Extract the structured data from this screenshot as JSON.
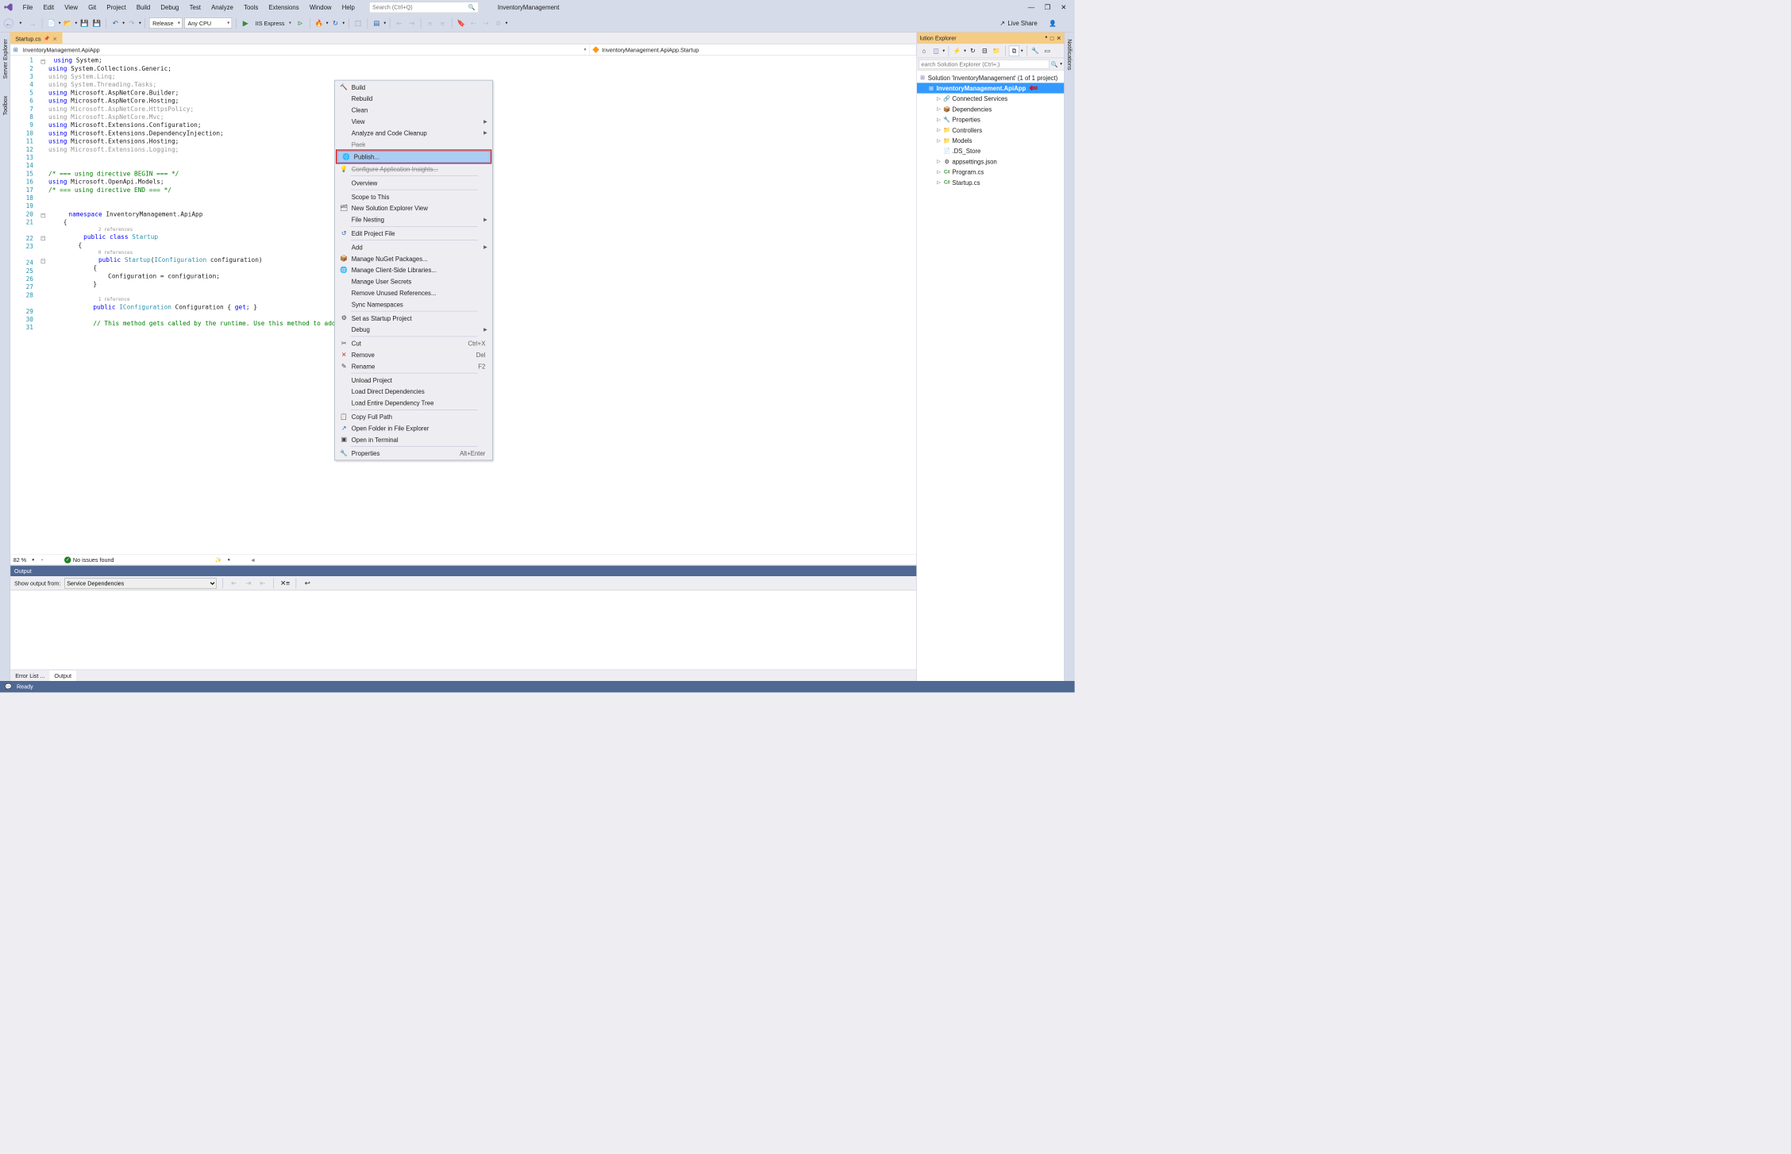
{
  "title": "InventoryManagement",
  "menu": [
    "File",
    "Edit",
    "View",
    "Git",
    "Project",
    "Build",
    "Debug",
    "Test",
    "Analyze",
    "Tools",
    "Extensions",
    "Window",
    "Help"
  ],
  "search_placeholder": "Search (Ctrl+Q)",
  "toolbar": {
    "config": "Release",
    "platform": "Any CPU",
    "run_target": "IIS Express",
    "live_share": "Live Share"
  },
  "left_rails": [
    "Server Explorer",
    "Toolbox"
  ],
  "right_rails": [
    "Notifications"
  ],
  "tab": {
    "name": "Startup.cs"
  },
  "nav": {
    "left": "InventoryManagement.ApiApp",
    "right": "InventoryManagement.ApiApp.Startup"
  },
  "code_lines": [
    {
      "n": 1,
      "html": "<span class='kw'>using</span> System;",
      "fold": "minus"
    },
    {
      "n": 2,
      "html": "<span class='kw'>using</span> System.Collections.Generic;"
    },
    {
      "n": 3,
      "html": "<span class='gray'>using System.Linq;</span>"
    },
    {
      "n": 4,
      "html": "<span class='gray'>using System.Threading.Tasks;</span>"
    },
    {
      "n": 5,
      "html": "<span class='kw'>using</span> Microsoft.AspNetCore.Builder;"
    },
    {
      "n": 6,
      "html": "<span class='kw'>using</span> Microsoft.AspNetCore.Hosting;"
    },
    {
      "n": 7,
      "html": "<span class='gray'>using Microsoft.AspNetCore.HttpsPolicy;</span>"
    },
    {
      "n": 8,
      "html": "<span class='gray'>using Microsoft.AspNetCore.Mvc;</span>"
    },
    {
      "n": 9,
      "html": "<span class='kw'>using</span> Microsoft.Extensions.Configuration;"
    },
    {
      "n": 10,
      "html": "<span class='kw'>using</span> Microsoft.Extensions.DependencyInjection;"
    },
    {
      "n": 11,
      "html": "<span class='kw'>using</span> Microsoft.Extensions.Hosting;"
    },
    {
      "n": 12,
      "html": "<span class='gray'>using Microsoft.Extensions.Logging;</span>"
    },
    {
      "n": 13,
      "html": ""
    },
    {
      "n": 14,
      "html": ""
    },
    {
      "n": 15,
      "html": "<span class='comment'>/* === using directive BEGIN === */</span>"
    },
    {
      "n": 16,
      "html": "<span class='kw'>using</span> Microsoft.OpenApi.Models;"
    },
    {
      "n": 17,
      "html": "<span class='comment'>/* === using directive END === */</span>"
    },
    {
      "n": 18,
      "html": ""
    },
    {
      "n": 19,
      "html": ""
    },
    {
      "n": 20,
      "html": "    <span class='kw'>namespace</span> InventoryManagement.ApiApp",
      "fold": "minus"
    },
    {
      "n": 21,
      "html": "    {"
    },
    {
      "ref": "2 references"
    },
    {
      "n": 22,
      "html": "        <span class='kw'>public</span> <span class='kw'>class</span> <span class='type'>Startup</span>",
      "fold": "minus"
    },
    {
      "n": 23,
      "html": "        {"
    },
    {
      "ref": "0 references"
    },
    {
      "n": 24,
      "html": "            <span class='kw'>public</span> <span class='type'>Startup</span>(<span class='type'>IConfiguration</span> configuration)",
      "fold": "minus"
    },
    {
      "n": 25,
      "html": "            {"
    },
    {
      "n": 26,
      "html": "                Configuration = configuration;"
    },
    {
      "n": 27,
      "html": "            }"
    },
    {
      "n": 28,
      "html": ""
    },
    {
      "ref": "1 reference"
    },
    {
      "n": 29,
      "html": "            <span class='kw'>public</span> <span class='type'>IConfiguration</span> Configuration { <span class='kw'>get</span>; }"
    },
    {
      "n": 30,
      "html": ""
    },
    {
      "n": 31,
      "html": "            <span class='comment'>// This method gets called by the runtime. Use this method to add services to</span>"
    }
  ],
  "editor_status": {
    "zoom": "82 %",
    "issues": "No issues found"
  },
  "output": {
    "title": "Output",
    "source_label": "Show output from:",
    "source": "Service Dependencies"
  },
  "bottom_tabs": [
    "Error List  ...",
    "Output"
  ],
  "status_text": "Ready",
  "solution_explorer": {
    "title": "lution Explorer",
    "search_placeholder": "earch Solution Explorer (Ctrl+;)",
    "root": "Solution 'InventoryManagement' (1 of 1 project)",
    "project": "InventoryManagement.ApiApp",
    "children": [
      {
        "icon": "🔗",
        "label": "Connected Services",
        "exp": true
      },
      {
        "icon": "📦",
        "label": "Dependencies",
        "exp": true
      },
      {
        "icon": "🔧",
        "label": "Properties",
        "exp": true
      },
      {
        "icon": "📁",
        "label": "Controllers",
        "exp": true
      },
      {
        "icon": "📁",
        "label": "Models",
        "exp": true
      },
      {
        "icon": "📄",
        "label": ".DS_Store",
        "exp": false
      },
      {
        "icon": "⚙",
        "label": "appsettings.json",
        "exp": true
      },
      {
        "icon": "C#",
        "label": "Program.cs",
        "exp": true,
        "cs": true
      },
      {
        "icon": "C#",
        "label": "Startup.cs",
        "exp": true,
        "cs": true
      }
    ]
  },
  "context_menu": [
    {
      "type": "item",
      "icon": "🔨",
      "label": "Build"
    },
    {
      "type": "item",
      "label": "Rebuild"
    },
    {
      "type": "item",
      "label": "Clean"
    },
    {
      "type": "item",
      "label": "View",
      "sub": true
    },
    {
      "type": "item",
      "label": "Analyze and Code Cleanup",
      "sub": true
    },
    {
      "type": "item",
      "label": "Pack",
      "strike": true
    },
    {
      "type": "item",
      "icon": "🌐",
      "label": "Publish...",
      "highlight": true
    },
    {
      "type": "item",
      "icon": "💡",
      "label": "Configure Application Insights...",
      "strike": true
    },
    {
      "type": "sep"
    },
    {
      "type": "item",
      "label": "Overview"
    },
    {
      "type": "sep"
    },
    {
      "type": "item",
      "label": "Scope to This"
    },
    {
      "type": "item",
      "icon": "🗂",
      "label": "New Solution Explorer View"
    },
    {
      "type": "item",
      "label": "File Nesting",
      "sub": true
    },
    {
      "type": "sep"
    },
    {
      "type": "item",
      "icon": "↺",
      "label": "Edit Project File"
    },
    {
      "type": "sep"
    },
    {
      "type": "item",
      "label": "Add",
      "sub": true
    },
    {
      "type": "item",
      "icon": "📦",
      "label": "Manage NuGet Packages..."
    },
    {
      "type": "item",
      "icon": "🌐",
      "label": "Manage Client-Side Libraries..."
    },
    {
      "type": "item",
      "label": "Manage User Secrets"
    },
    {
      "type": "item",
      "label": "Remove Unused References..."
    },
    {
      "type": "item",
      "label": "Sync Namespaces"
    },
    {
      "type": "sep"
    },
    {
      "type": "item",
      "icon": "⚙",
      "label": "Set as Startup Project"
    },
    {
      "type": "item",
      "label": "Debug",
      "sub": true
    },
    {
      "type": "sep"
    },
    {
      "type": "item",
      "icon": "✂",
      "label": "Cut",
      "shortcut": "Ctrl+X"
    },
    {
      "type": "item",
      "icon": "✕",
      "label": "Remove",
      "shortcut": "Del"
    },
    {
      "type": "item",
      "icon": "✎",
      "label": "Rename",
      "shortcut": "F2"
    },
    {
      "type": "sep"
    },
    {
      "type": "item",
      "label": "Unload Project"
    },
    {
      "type": "item",
      "label": "Load Direct Dependencies"
    },
    {
      "type": "item",
      "label": "Load Entire Dependency Tree"
    },
    {
      "type": "sep"
    },
    {
      "type": "item",
      "icon": "📋",
      "label": "Copy Full Path"
    },
    {
      "type": "item",
      "icon": "↗",
      "label": "Open Folder in File Explorer"
    },
    {
      "type": "item",
      "icon": "▣",
      "label": "Open in Terminal"
    },
    {
      "type": "sep"
    },
    {
      "type": "item",
      "icon": "🔧",
      "label": "Properties",
      "shortcut": "Alt+Enter"
    }
  ]
}
